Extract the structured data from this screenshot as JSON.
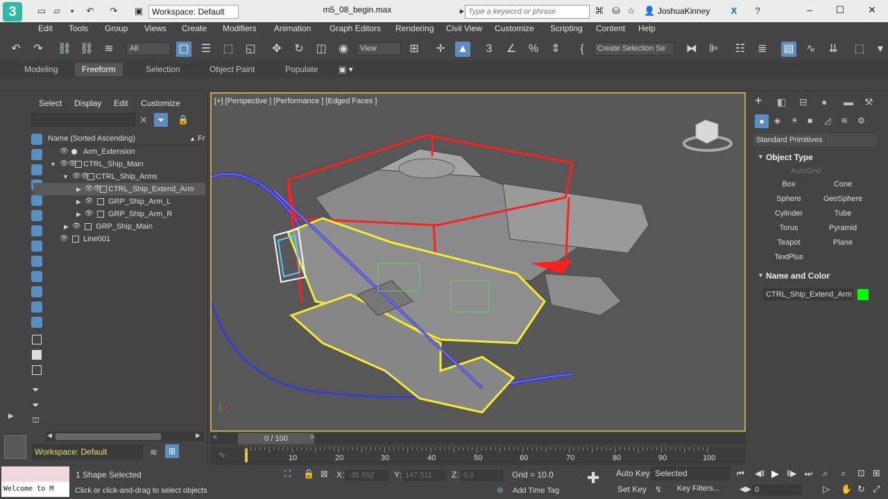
{
  "titlebar": {
    "workspace": "Workspace: Default",
    "document": "m5_08_begin.max",
    "search_placeholder": "Type a keyword or phrase",
    "user": "JoshuaKinney"
  },
  "menu": [
    "Edit",
    "Tools",
    "Group",
    "Views",
    "Create",
    "Modifiers",
    "Animation",
    "Graph Editors",
    "Rendering",
    "Civil View",
    "Customize",
    "Scripting",
    "Content",
    "Help"
  ],
  "toolbar": {
    "filter": "All",
    "ref_coord": "View",
    "selection_set": "Create Selection Se"
  },
  "ribbon": {
    "tabs": [
      "Modeling",
      "Freeform",
      "Selection",
      "Object Paint",
      "Populate"
    ]
  },
  "explorer": {
    "tabs": [
      "Select",
      "Display",
      "Edit",
      "Customize"
    ],
    "column": "Name (Sorted Ascending)",
    "column2": "Fr",
    "rows": [
      "Arm_Extension",
      "CTRL_Ship_Main",
      "CTRL_Ship_Arms",
      "CTRL_Ship_Extend_Arm",
      "GRP_Ship_Arm_L",
      "GRP_Ship_Arm_R",
      "GRP_Ship_Main",
      "Line001"
    ],
    "workspace": "Workspace: Default"
  },
  "viewport": {
    "label": "[+] [Perspective ] [Performance ] [Edged Faces ]"
  },
  "timeline": {
    "frame": "0 / 100",
    "ticks": [
      "10",
      "20",
      "30",
      "40",
      "50",
      "60",
      "70",
      "80",
      "90",
      "100"
    ]
  },
  "command_panel": {
    "category": "Standard Primitives",
    "object_type_title": "Object Type",
    "autogrid": "AutoGrid",
    "primitives": [
      "Box",
      "Cone",
      "Sphere",
      "GeoSphere",
      "Cylinder",
      "Tube",
      "Torus",
      "Pyramid",
      "Teapot",
      "Plane",
      "TextPlus"
    ],
    "name_color_title": "Name and Color",
    "object_name": "CTRL_Ship_Extend_Arm",
    "object_color": "#00ff00"
  },
  "status": {
    "maxscript": "Welcome to M",
    "selection": "1 Shape Selected",
    "prompt": "Click or click-and-drag to select objects",
    "x_label": "X:",
    "x": "-35.552",
    "y_label": "Y:",
    "y": "147.511",
    "z_label": "Z:",
    "z": "0.0",
    "grid": "Grid = 10.0",
    "add_time_tag": "Add Time Tag",
    "auto_key": "Auto Key",
    "set_key": "Set Key",
    "key_mode": "Selected",
    "key_filters": "Key Filters...",
    "frame_field": "0"
  }
}
